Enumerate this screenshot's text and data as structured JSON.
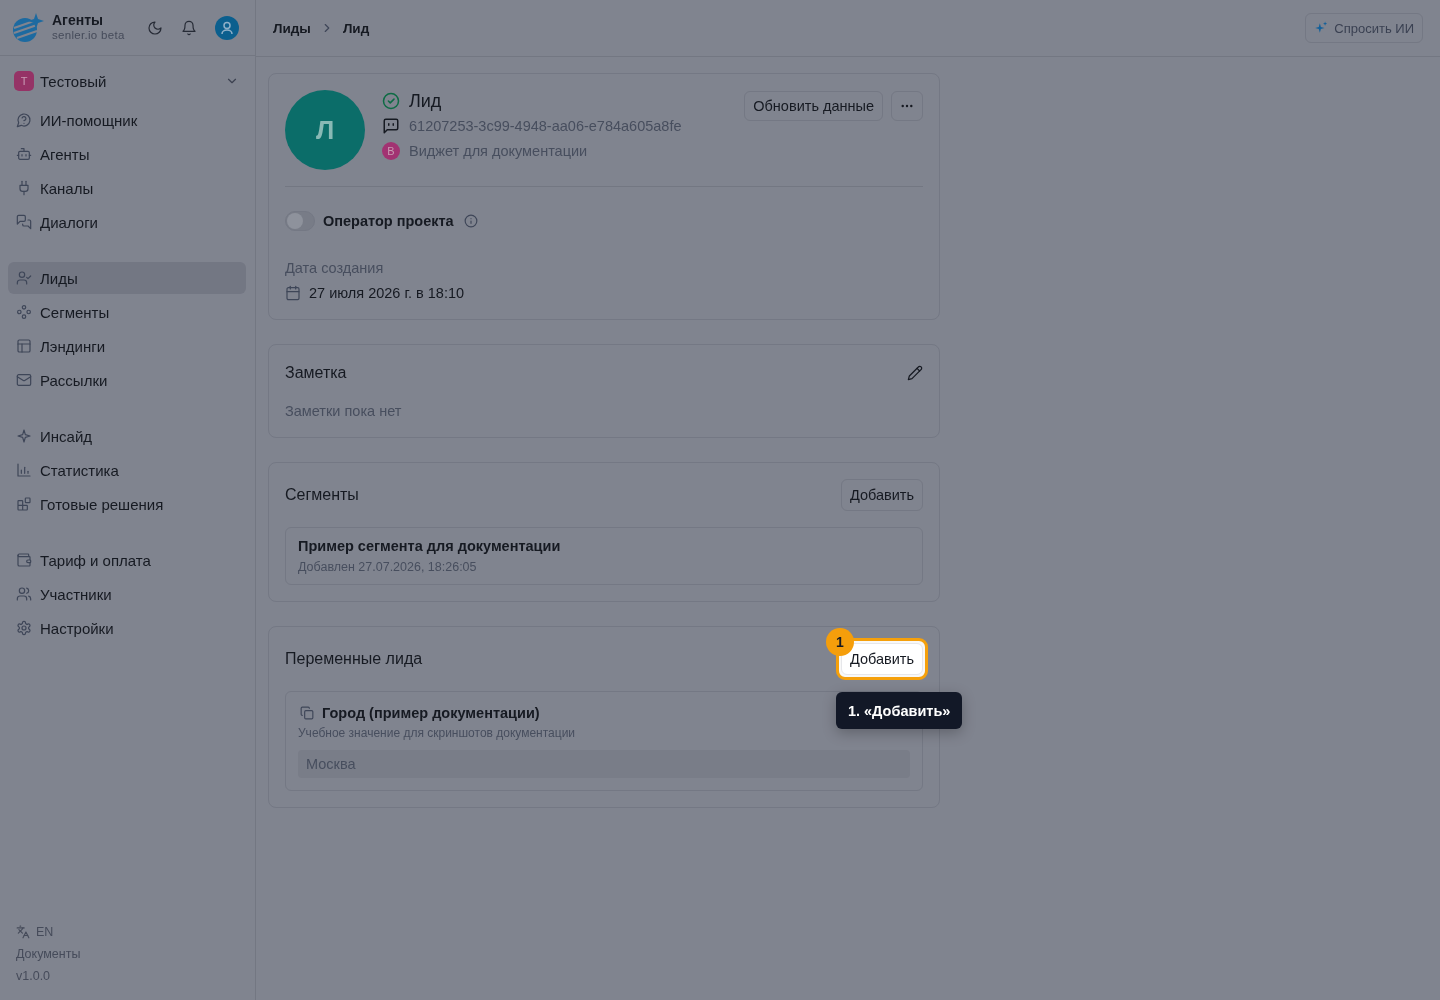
{
  "sidebar": {
    "brand": {
      "title": "Агенты",
      "subtitle": "senler.io beta"
    },
    "workspace": {
      "initial": "Т",
      "name": "Тестовый"
    },
    "nav_groups": [
      {
        "items": [
          {
            "label": "ИИ-помощник",
            "selected": false
          },
          {
            "label": "Агенты",
            "selected": false
          },
          {
            "label": "Каналы",
            "selected": false
          },
          {
            "label": "Диалоги",
            "selected": false
          }
        ]
      },
      {
        "items": [
          {
            "label": "Лиды",
            "selected": true
          },
          {
            "label": "Сегменты",
            "selected": false
          },
          {
            "label": "Лэндинги",
            "selected": false
          },
          {
            "label": "Рассылки",
            "selected": false
          }
        ]
      },
      {
        "items": [
          {
            "label": "Инсайд",
            "selected": false
          },
          {
            "label": "Статистика",
            "selected": false
          },
          {
            "label": "Готовые решения",
            "selected": false
          }
        ]
      },
      {
        "items": [
          {
            "label": "Тариф и оплата",
            "selected": false
          },
          {
            "label": "Участники",
            "selected": false
          },
          {
            "label": "Настройки",
            "selected": false
          }
        ]
      }
    ],
    "footer": {
      "language": "EN",
      "docs_link": "Документы",
      "version": "v1.0.0"
    }
  },
  "header": {
    "breadcrumbs": [
      {
        "label": "Лиды"
      },
      {
        "label": "Лид"
      }
    ],
    "ask_button": "Спросить ИИ"
  },
  "lead": {
    "avatar_initial": "Л",
    "name": "Лид",
    "id": "61207253-3c99-4948-aa06-e784a605a8fe",
    "source": {
      "initial": "В",
      "name": "Виджет для документации"
    },
    "refresh_button": "Обновить данные",
    "operator_toggle": {
      "label": "Оператор проекта",
      "on": false
    },
    "created": {
      "label": "Дата создания",
      "value": "27 июля 2026 г. в 18:10"
    }
  },
  "note": {
    "title": "Заметка",
    "empty_text": "Заметки пока нет"
  },
  "segments": {
    "title": "Сегменты",
    "add_button": {
      "label": "Добавить",
      "highlighted": false
    },
    "items": [
      {
        "name": "Пример сегмента для документации",
        "added": "Добавлен 27.07.2026, 18:26:05"
      }
    ]
  },
  "variables": {
    "title": "Переменные лида",
    "add_button": {
      "label": "Добавить",
      "highlighted": true
    },
    "items": [
      {
        "name": "Город (пример документации)",
        "description": "Учебное значение для скриншотов документации",
        "value": "Москва"
      }
    ]
  },
  "tour": {
    "step_badge": "1",
    "tooltip": "1. «Добавить»"
  }
}
